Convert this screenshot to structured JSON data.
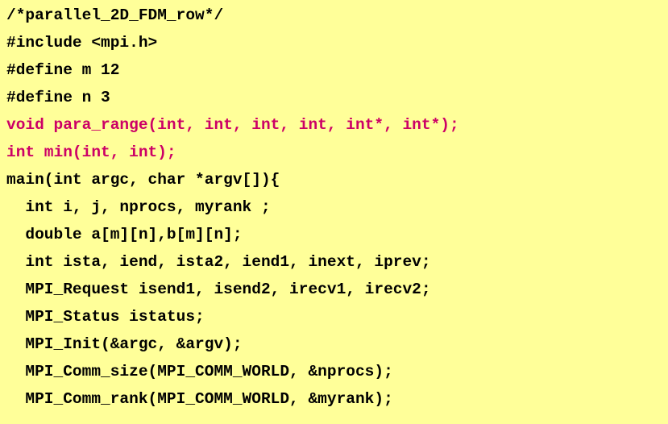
{
  "colors": {
    "background": "#ffff99",
    "code_text": "#000000",
    "prototype_text": "#cc0066"
  },
  "code": {
    "lines": [
      {
        "text": "/*parallel_2D_FDM_row*/",
        "style": "normal"
      },
      {
        "text": "#include <mpi.h>",
        "style": "normal"
      },
      {
        "text": "#define m 12",
        "style": "normal"
      },
      {
        "text": "#define n 3",
        "style": "normal"
      },
      {
        "text": "void para_range(int, int, int, int, int*, int*);",
        "style": "proto"
      },
      {
        "text": "int min(int, int);",
        "style": "proto"
      },
      {
        "text": "main(int argc, char *argv[]){",
        "style": "normal"
      },
      {
        "text": "  int i, j, nprocs, myrank ;",
        "style": "normal"
      },
      {
        "text": "  double a[m][n],b[m][n];",
        "style": "normal"
      },
      {
        "text": "  int ista, iend, ista2, iend1, inext, iprev;",
        "style": "normal"
      },
      {
        "text": "  MPI_Request isend1, isend2, irecv1, irecv2;",
        "style": "normal"
      },
      {
        "text": "  MPI_Status istatus;",
        "style": "normal"
      },
      {
        "text": "  MPI_Init(&argc, &argv);",
        "style": "normal"
      },
      {
        "text": "  MPI_Comm_size(MPI_COMM_WORLD, &nprocs);",
        "style": "normal"
      },
      {
        "text": "  MPI_Comm_rank(MPI_COMM_WORLD, &myrank);",
        "style": "normal"
      }
    ]
  }
}
